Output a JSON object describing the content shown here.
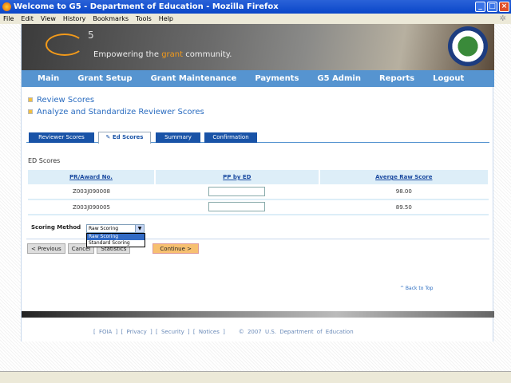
{
  "window": {
    "title": "Welcome to G5 - Department of Education - Mozilla Firefox"
  },
  "menu": [
    "File",
    "Edit",
    "View",
    "History",
    "Bookmarks",
    "Tools",
    "Help"
  ],
  "banner": {
    "logo_sup": "5",
    "tagline_a": "Empowering the ",
    "tagline_b": "grant",
    "tagline_c": " community."
  },
  "nav": [
    "Main",
    "Grant Setup",
    "Grant Maintenance",
    "Payments",
    "G5 Admin",
    "Reports",
    "Logout"
  ],
  "links": [
    "Review Scores",
    "Analyze and Standardize Reviewer Scores"
  ],
  "tabs": [
    "Reviewer Scores",
    "Ed Scores",
    "Summary",
    "Confirmation"
  ],
  "section_title": "ED Scores",
  "table": {
    "headers": [
      "PR/Award No.",
      "PP by ED",
      "Averge Raw Score"
    ],
    "rows": [
      {
        "award": "Z003J090008",
        "pp": "",
        "score": "98.00"
      },
      {
        "award": "Z003J090005",
        "pp": "",
        "score": "89.50"
      }
    ]
  },
  "scoring": {
    "label": "Scoring Method",
    "selected": "Raw Scoring",
    "options": [
      "Raw Scoring",
      "Standard Scoring"
    ]
  },
  "buttons": {
    "previous": "< Previous",
    "cancel": "Cancel",
    "statistics": "Statistics",
    "continue": "Continue >"
  },
  "back_to_top": "^ Back to Top",
  "footer": "[ FOIA ] [ Privacy ] [ Security ] [ Notices ]    © 2007 U.S. Department of Education",
  "colors": {
    "nav": "#5694d0",
    "tab": "#1953a7",
    "accent": "#f29a1a"
  }
}
